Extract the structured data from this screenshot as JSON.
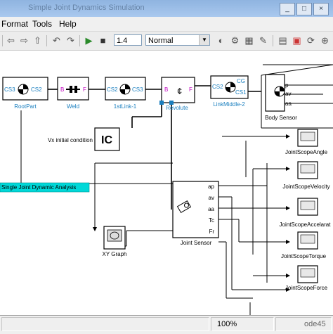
{
  "window": {
    "title": "Simple Joint Dynamics Simulation",
    "minimize": "_",
    "maximize": "□",
    "close": "×"
  },
  "menu": {
    "format": "Format",
    "tools": "Tools",
    "help": "Help"
  },
  "toolbar": {
    "sim_time": "1.4",
    "sim_mode": "Normal"
  },
  "blocks": {
    "rootpart": {
      "label": "RootPart",
      "port_left": "CS3",
      "port_right": "CS2"
    },
    "weld": {
      "label": "Weld",
      "port_b": "B",
      "port_f": "F"
    },
    "link1": {
      "label": "1stLink-1",
      "port_left": "CS2",
      "port_right": "CS3"
    },
    "revolute": {
      "label": "Revolute",
      "port_b": "B",
      "port_f": "F"
    },
    "linkmiddle": {
      "label": "LinkMiddle-2",
      "port_cs2": "CS2",
      "port_cg": "CG",
      "port_cs1": "CS1"
    },
    "body_sensor": {
      "label": "Body Sensor",
      "port_p": "p",
      "port_av": "av",
      "port_aa": "aa"
    },
    "ic": {
      "text": "IC",
      "label": "Vx initial condition"
    },
    "analysis_label": "Single Joint Dynamic Analysis",
    "joint_sensor": {
      "label": "Joint Sensor",
      "ports": [
        "ap",
        "av",
        "aa",
        "Tc",
        "Fr"
      ]
    },
    "xy_graph": {
      "label": "XY Graph"
    },
    "scopes": [
      "JointScopeAngle",
      "JointScopeVelocity",
      "JointScopeAccelarat",
      "JointScopeTorque",
      "JointScopeForce"
    ]
  },
  "status": {
    "zoom": "100%",
    "right": "ode45"
  },
  "colors": {
    "port_blue": "#1a7fbf",
    "port_magenta": "#c000c0",
    "highlight_cyan": "#00d8d8"
  }
}
